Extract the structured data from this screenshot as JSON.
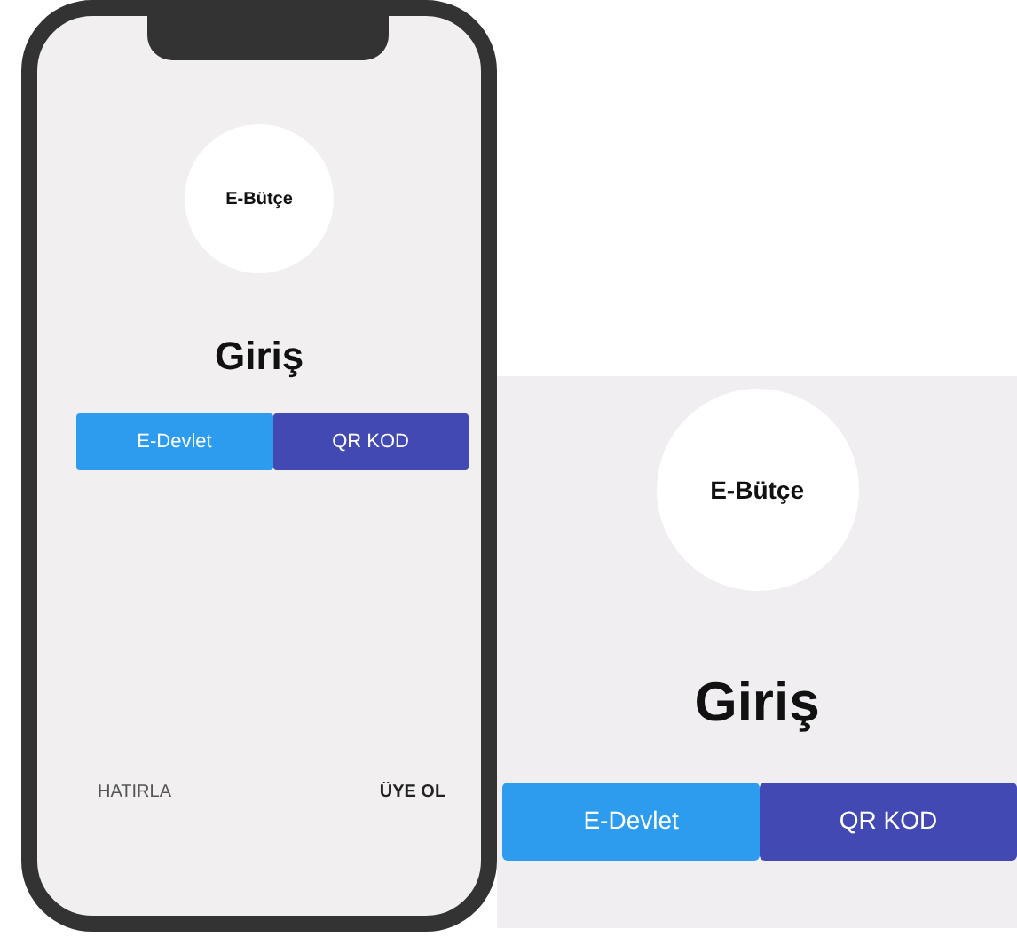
{
  "phone": {
    "logo": "E-Bütçe",
    "title": "Giriş",
    "buttons": [
      {
        "label": "E-Devlet",
        "color": "#2d9cee"
      },
      {
        "label": "QR KOD",
        "color": "#4249b2"
      }
    ],
    "footer_links": [
      "HATIRLA",
      "ÜYE OL"
    ]
  },
  "zoom_panel": {
    "logo": "E-Bütçe",
    "title": "Giriş",
    "buttons": [
      {
        "label": "E-Devlet",
        "color": "#2d9cee"
      },
      {
        "label": "QR KOD",
        "color": "#4249b2"
      }
    ]
  }
}
